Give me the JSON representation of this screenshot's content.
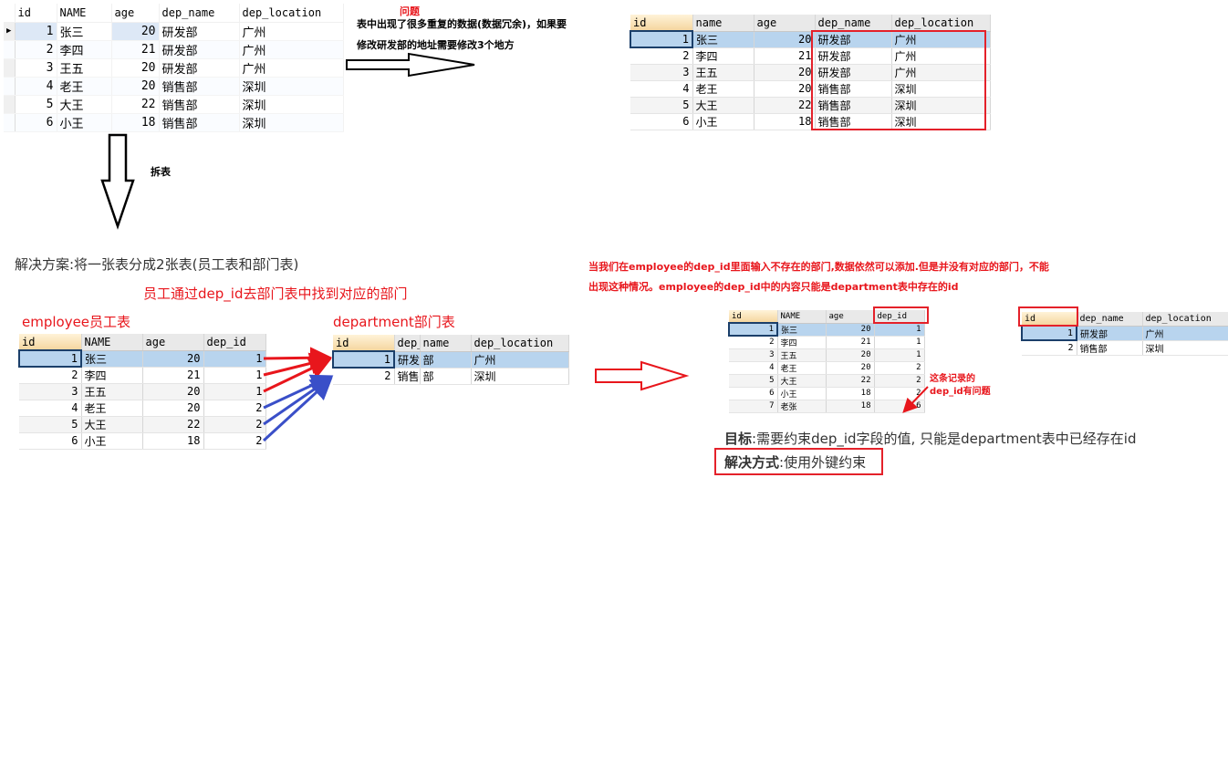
{
  "grid_original": {
    "columns": [
      "id",
      "NAME",
      "age",
      "dep_name",
      "dep_location"
    ],
    "rows": [
      [
        "1",
        "张三",
        "20",
        "研发部",
        "广州"
      ],
      [
        "2",
        "李四",
        "21",
        "研发部",
        "广州"
      ],
      [
        "3",
        "王五",
        "20",
        "研发部",
        "广州"
      ],
      [
        "4",
        "老王",
        "20",
        "销售部",
        "深圳"
      ],
      [
        "5",
        "大王",
        "22",
        "销售部",
        "深圳"
      ],
      [
        "6",
        "小王",
        "18",
        "销售部",
        "深圳"
      ]
    ]
  },
  "problem": {
    "title": "问题",
    "line1": "表中出现了很多重复的数据(数据冗余)，如果要",
    "line2": "修改研发部的地址需要修改3个地方"
  },
  "grid_problem": {
    "columns": [
      "id",
      "name",
      "age",
      "dep_name",
      "dep_location"
    ],
    "rows": [
      [
        "1",
        "张三",
        "20",
        "研发部",
        "广州"
      ],
      [
        "2",
        "李四",
        "21",
        "研发部",
        "广州"
      ],
      [
        "3",
        "王五",
        "20",
        "研发部",
        "广州"
      ],
      [
        "4",
        "老王",
        "20",
        "销售部",
        "深圳"
      ],
      [
        "5",
        "大王",
        "22",
        "销售部",
        "深圳"
      ],
      [
        "6",
        "小王",
        "18",
        "销售部",
        "深圳"
      ]
    ]
  },
  "split_label": "拆表",
  "solution_text": "解决方案:将一张表分成2张表(员工表和部门表)",
  "link_text": "员工通过dep_id去部门表中找到对应的部门",
  "employee": {
    "title": "employee员工表",
    "columns": [
      "id",
      "NAME",
      "age",
      "dep_id"
    ],
    "rows": [
      [
        "1",
        "张三",
        "20",
        "1"
      ],
      [
        "2",
        "李四",
        "21",
        "1"
      ],
      [
        "3",
        "王五",
        "20",
        "1"
      ],
      [
        "4",
        "老王",
        "20",
        "2"
      ],
      [
        "5",
        "大王",
        "22",
        "2"
      ],
      [
        "6",
        "小王",
        "18",
        "2"
      ]
    ]
  },
  "department": {
    "title": "department部门表",
    "columns": [
      "id",
      "dep_",
      "name",
      "dep_location"
    ],
    "rows": [
      [
        "1",
        "研发",
        "部",
        "广州"
      ],
      [
        "2",
        "销售",
        "部",
        "深圳"
      ]
    ]
  },
  "fk_problem": {
    "line1": "当我们在employee的dep_id里面输入不存在的部门,数据依然可以添加.但是并没有对应的部门，不能",
    "line2": "出现这种情况。employee的dep_id中的内容只能是department表中存在的id"
  },
  "employee_small": {
    "columns": [
      "id",
      "NAME",
      "age",
      "dep_id"
    ],
    "rows": [
      [
        "1",
        "张三",
        "20",
        "1"
      ],
      [
        "2",
        "李四",
        "21",
        "1"
      ],
      [
        "3",
        "王五",
        "20",
        "1"
      ],
      [
        "4",
        "老王",
        "20",
        "2"
      ],
      [
        "5",
        "大王",
        "22",
        "2"
      ],
      [
        "6",
        "小王",
        "18",
        "2"
      ],
      [
        "7",
        "老张",
        "18",
        "6"
      ]
    ]
  },
  "department_small": {
    "columns": [
      "id",
      "dep_name",
      "dep_location"
    ],
    "rows": [
      [
        "1",
        "研发部",
        "广州"
      ],
      [
        "2",
        "销售部",
        "深圳"
      ]
    ]
  },
  "bad_record_note": {
    "line1": "这条记录的",
    "line2": "dep_id有问题"
  },
  "goal": {
    "label": "目标",
    "text": ":需要约束dep_id字段的值, 只能是department表中已经存在id"
  },
  "method": {
    "label": "解决方式",
    "text": ":使用外键约束"
  },
  "colors": {
    "red": "#e8161c",
    "blue_arrow": "#3a4fc8",
    "selection": "#b8d4ee",
    "highlight_header": "#f5d6a0"
  }
}
